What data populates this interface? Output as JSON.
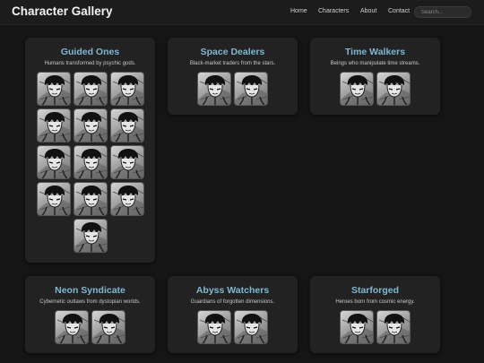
{
  "header": {
    "title": "Character Gallery",
    "nav": [
      "Home",
      "Characters",
      "About",
      "Contact"
    ],
    "search_placeholder": "Search..."
  },
  "groups": [
    {
      "title": "Guided Ones",
      "description": "Humans transformed by psychic gods.",
      "avatar_count": 13
    },
    {
      "title": "Space Dealers",
      "description": "Black-market traders from the stars.",
      "avatar_count": 2
    },
    {
      "title": "Time Walkers",
      "description": "Beings who manipulate time streams.",
      "avatar_count": 2
    },
    {
      "title": "Neon Syndicate",
      "description": "Cybernetic outlaws from dystopian worlds.",
      "avatar_count": 2
    },
    {
      "title": "Abyss Watchers",
      "description": "Guardians of forgotten dimensions.",
      "avatar_count": 2
    },
    {
      "title": "Starforged",
      "description": "Heroes born from cosmic energy.",
      "avatar_count": 2
    }
  ]
}
